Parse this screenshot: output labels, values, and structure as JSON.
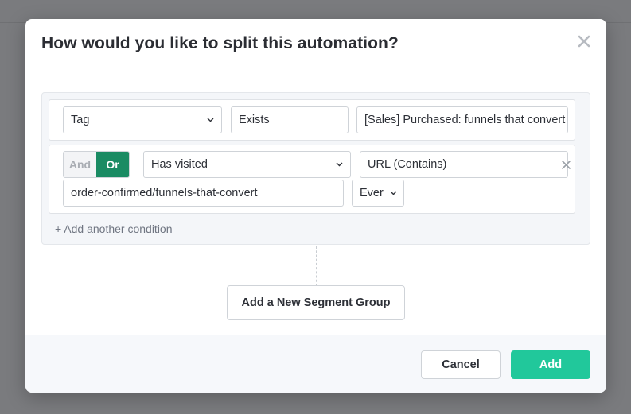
{
  "modal": {
    "title": "How would you like to split this automation?"
  },
  "conditions": [
    {
      "type": "Tag",
      "operator": "Exists",
      "value": "[Sales] Purchased: funnels that convert"
    },
    {
      "logic": {
        "and_label": "And",
        "or_label": "Or",
        "selected": "Or"
      },
      "type": "Has visited",
      "url_operator": "URL (Contains)",
      "url_value": "order-confirmed/funnels-that-convert",
      "timeframe": "Ever"
    }
  ],
  "add_condition_label": "+ Add another condition",
  "add_segment_group_label": "Add a New Segment Group",
  "footer": {
    "cancel_label": "Cancel",
    "add_label": "Add"
  },
  "colors": {
    "or_active": "#1a8b63",
    "add_button": "#21c89b"
  }
}
